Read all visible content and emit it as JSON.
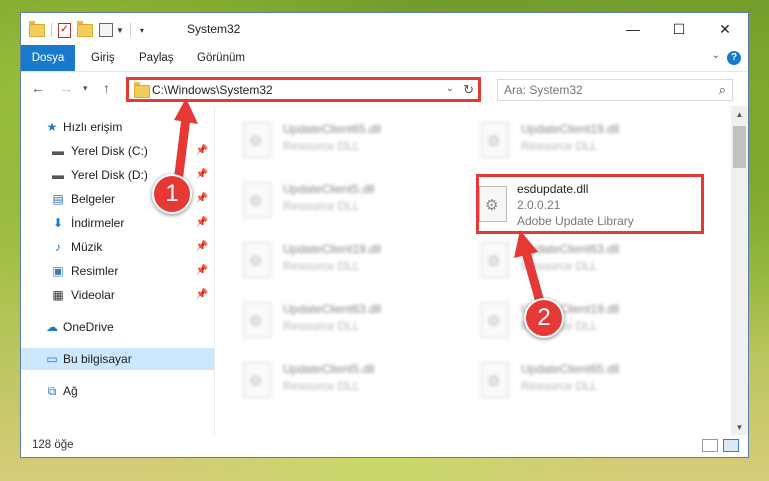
{
  "window": {
    "title": "System32",
    "controls": {
      "minimize": "—",
      "maximize": "☐",
      "close": "✕"
    }
  },
  "ribbon": {
    "tabs": [
      "Dosya",
      "Giriş",
      "Paylaş",
      "Görünüm"
    ],
    "help": "?"
  },
  "address": {
    "path": "C:\\Windows\\System32",
    "search_placeholder": "Ara: System32"
  },
  "nav": {
    "quick_access": "Hızlı erişim",
    "items": [
      {
        "label": "Yerel Disk (C:)",
        "icon": "drive-icon",
        "pinned": true
      },
      {
        "label": "Yerel Disk (D:)",
        "icon": "drive-icon",
        "pinned": true
      },
      {
        "label": "Belgeler",
        "icon": "documents-icon",
        "pinned": true
      },
      {
        "label": "İndirmeler",
        "icon": "downloads-icon",
        "pinned": true
      },
      {
        "label": "Müzik",
        "icon": "music-icon",
        "pinned": true
      },
      {
        "label": "Resimler",
        "icon": "pictures-icon",
        "pinned": true
      },
      {
        "label": "Videolar",
        "icon": "videos-icon",
        "pinned": true
      }
    ],
    "onedrive": "OneDrive",
    "this_pc": "Bu bilgisayar",
    "network": "Ağ"
  },
  "files": {
    "left": [
      {
        "name": "UpdateClient65.dll",
        "type": "Resource DLL"
      },
      {
        "name": "UpdateClient5.dll",
        "type": "Resource DLL"
      },
      {
        "name": "UpdateClient19.dll",
        "type": "Resource DLL"
      },
      {
        "name": "UpdateClient63.dll",
        "type": "Resource DLL"
      },
      {
        "name": "UpdateClient5.dll",
        "type": "Resource DLL"
      }
    ],
    "right": [
      {
        "name": "UpdateClient19.dll",
        "type": "Resource DLL"
      },
      {
        "name": "esdupdate.dll",
        "version": "2.0.0.21",
        "type": "Adobe Update Library",
        "highlighted": true
      },
      {
        "name": "UpdateClient63.dll",
        "type": "Resource DLL"
      },
      {
        "name": "UpdateClient19.dll",
        "type": "Resource DLL"
      },
      {
        "name": "UpdateClient65.dll",
        "type": "Resource DLL"
      }
    ]
  },
  "status": {
    "count": "128 öğe"
  },
  "annotations": {
    "step1": "1",
    "step2": "2",
    "color": "#e53935"
  }
}
